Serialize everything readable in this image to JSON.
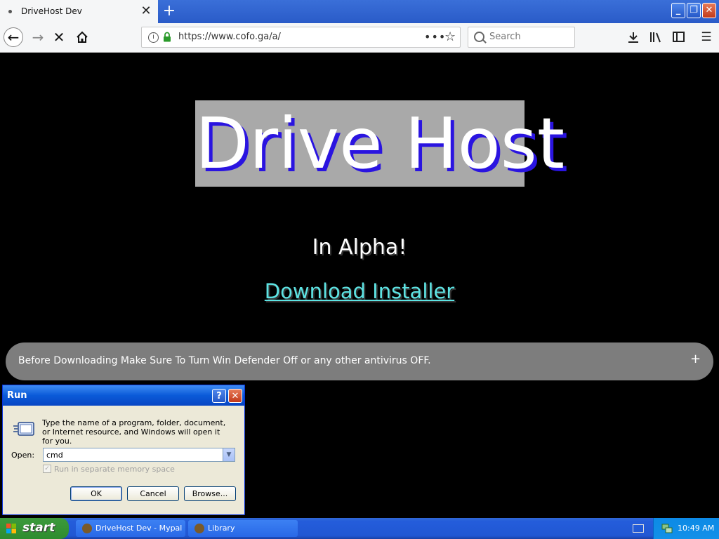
{
  "browser": {
    "tab_title": "DriveHost Dev",
    "tab_close": "✕",
    "new_tab": "+",
    "url": "https://www.cofo.ga/a/",
    "search_placeholder": "Search",
    "window_controls": {
      "minimize": "_",
      "maximize": "❐",
      "close": "✕"
    }
  },
  "page": {
    "logo": "Drive Host",
    "subtitle": "In Alpha!",
    "download_link": "Download Installer",
    "notice": "Before Downloading Make Sure To Turn Win Defender Off or any other antivirus OFF.",
    "notice_expand": "+"
  },
  "run_dialog": {
    "title": "Run",
    "help": "?",
    "close": "✕",
    "description": "Type the name of a program, folder, document, or Internet resource, and Windows will open it for you.",
    "open_label": "Open:",
    "open_value": "cmd",
    "checkbox_label": "Run in separate memory space",
    "ok": "OK",
    "cancel": "Cancel",
    "browse": "Browse..."
  },
  "taskbar": {
    "start": "start",
    "tasks": [
      {
        "label": "DriveHost Dev - Mypal"
      },
      {
        "label": "Library"
      }
    ],
    "clock": "10:49 AM"
  }
}
